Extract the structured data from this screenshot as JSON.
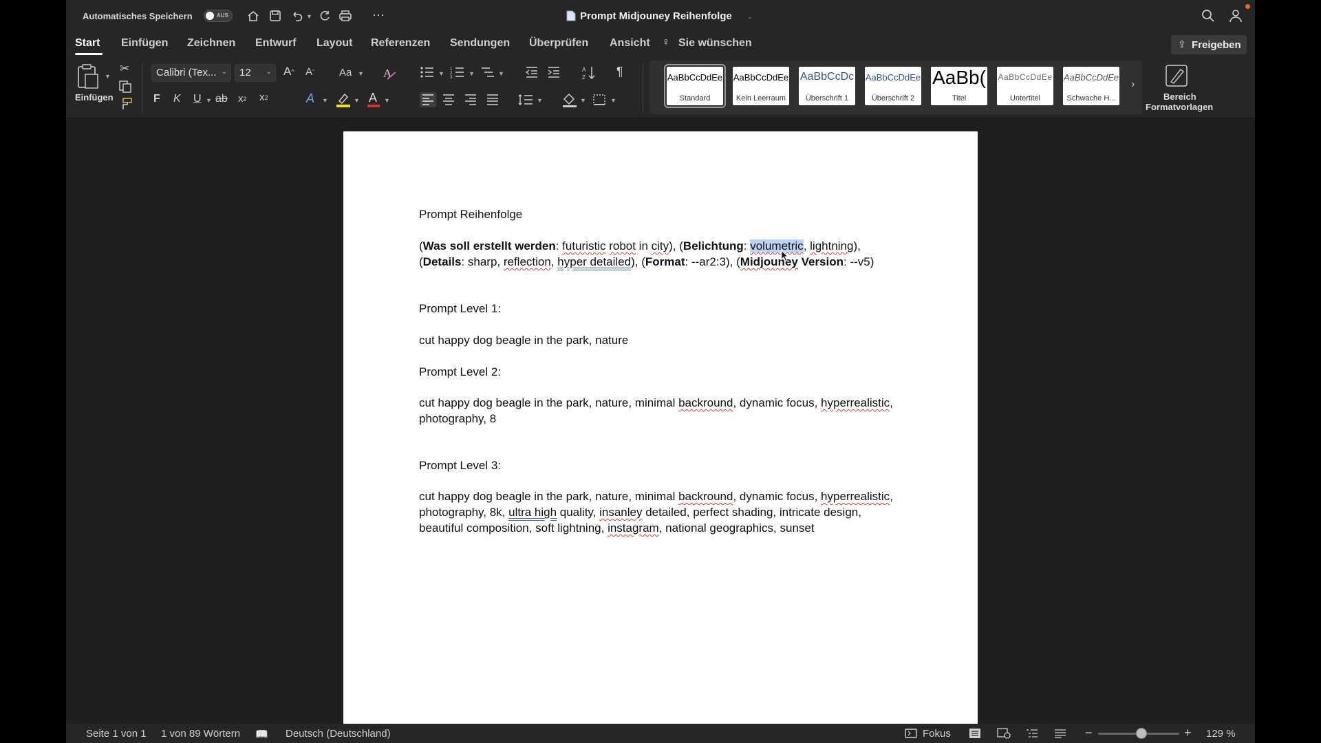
{
  "titlebar": {
    "autosave_label": "Automatisches Speichern",
    "autosave_state": "AUS",
    "doc_title": "Prompt Midjouney Reihenfolge"
  },
  "ribbon": {
    "tabs": [
      {
        "label": "Start",
        "active": true
      },
      {
        "label": "Einfügen"
      },
      {
        "label": "Zeichnen"
      },
      {
        "label": "Entwurf"
      },
      {
        "label": "Layout"
      },
      {
        "label": "Referenzen"
      },
      {
        "label": "Sendungen"
      },
      {
        "label": "Überprüfen"
      },
      {
        "label": "Ansicht"
      },
      {
        "label": "Sie wünschen"
      }
    ],
    "share_label": "Freigeben",
    "paste_label": "Einfügen",
    "font_name": "Calibri (Tex...",
    "font_size": "12",
    "styles": [
      {
        "sample": "AaBbCcDdEe",
        "label": "Standard",
        "selected": true
      },
      {
        "sample": "AaBbCcDdEe",
        "label": "Kein Leerraum"
      },
      {
        "sample": "AaBbCcDc",
        "label": "Überschrift 1"
      },
      {
        "sample": "AaBbCcDdEe",
        "label": "Überschrift 2"
      },
      {
        "sample": "AaBb(",
        "label": "Titel"
      },
      {
        "sample": "AaBbCcDdEe",
        "label": "Untertitel"
      },
      {
        "sample": "AaBbCcDdEe",
        "label": "Schwache H..."
      }
    ],
    "styles_pane_label_1": "Bereich",
    "styles_pane_label_2": "Formatvorlagen",
    "accent_highlight": "#f2e600",
    "accent_font_color": "#e0302b"
  },
  "document": {
    "title": "Prompt Reihenfolge",
    "line1": {
      "p1": "(",
      "b1": "Was soll erstellt werden",
      "p2": ": ",
      "w1": "futuristic",
      "p3": " ",
      "w2": "robot",
      "p4": " in ",
      "w3": "city",
      "p5": "), (",
      "b2": "Belichtung",
      "p6": ": ",
      "w4": "volumetric",
      "p7": ", ",
      "w5": "lightning",
      "p8": "),"
    },
    "line2": {
      "p1": "(",
      "b1": "Details",
      "p2": ": sharp, ",
      "w1": "reflection",
      "p3": ", ",
      "w2": "hyper detailed",
      "p4": "), (",
      "b2": "Format",
      "p5": ": --ar2:3), (",
      "b3": "Midjouney",
      "b4": " Version",
      "p6": ": --v5)"
    },
    "level1_heading": "Prompt Level 1:",
    "level1_text": "cut happy dog beagle in the park, nature",
    "level2_heading": "Prompt Level 2:",
    "level2_line1": {
      "p1": "cut happy dog beagle in the park, nature, minimal ",
      "w1": "backround",
      "p2": ", dynamic focus, ",
      "w2": "hyperrealistic",
      "p3": ","
    },
    "level2_line2": "photography, 8",
    "level3_heading": "Prompt Level 3:",
    "level3_line1": {
      "p1": "cut happy dog beagle in the park, nature, minimal ",
      "w1": "backround",
      "p2": ", dynamic focus, ",
      "w2": "hyperrealistic",
      "p3": ","
    },
    "level3_line2": {
      "p1": "photography, 8k, ",
      "w1": "ultra high",
      "p2": " quality, ",
      "w2": "insanley",
      "p3": " detailed, perfect shading, intricate design,"
    },
    "level3_line3": {
      "p1": "beautiful composition, soft lightning, ",
      "w1": "instagram",
      "p2": ", national geographics, sunset"
    }
  },
  "statusbar": {
    "page": "Seite 1 von 1",
    "words": "1 von 89 Wörtern",
    "language": "Deutsch (Deutschland)",
    "focus": "Fokus",
    "zoom": "129 %",
    "zoom_level_percent": 129
  }
}
